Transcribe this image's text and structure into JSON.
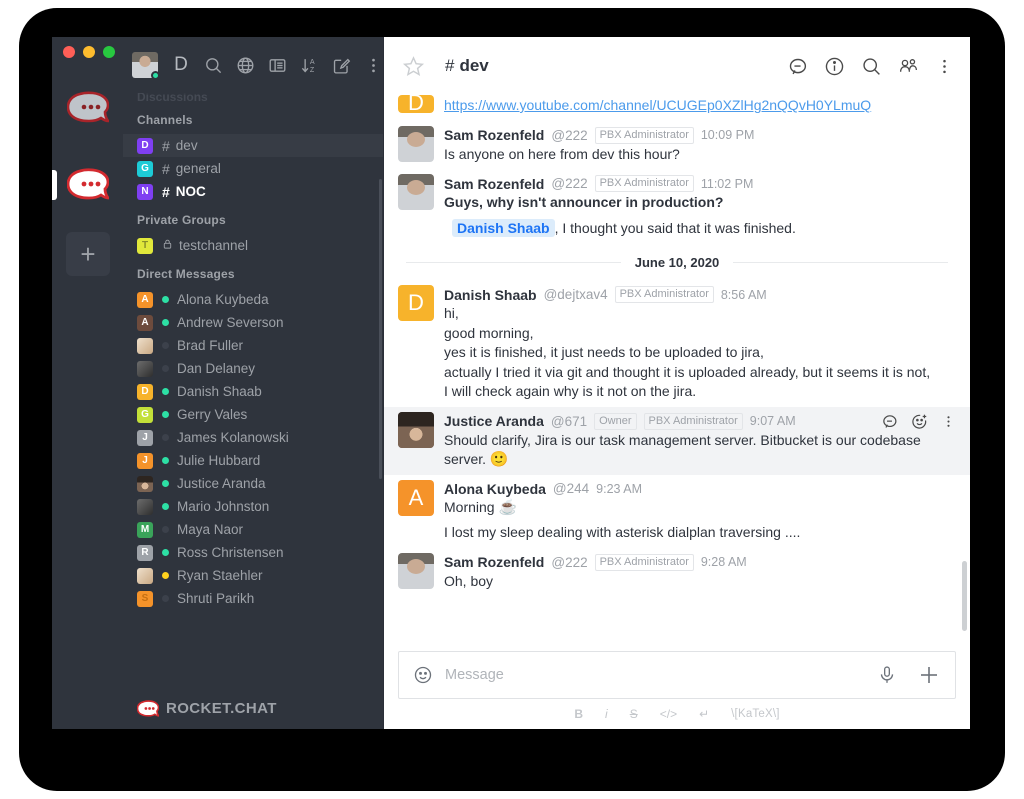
{
  "window": {
    "traffic_lights": [
      "close",
      "minimize",
      "maximize"
    ]
  },
  "rail": {
    "servers": [
      {
        "name": "rocket-chat-server-1",
        "active": false
      },
      {
        "name": "rocket-chat-server-2",
        "active": true
      }
    ],
    "add_label": "+"
  },
  "sidebar": {
    "toolbar": {
      "avatar_status": "online",
      "home_letter": "D",
      "icons": [
        "home-letter",
        "search-icon",
        "directory-globe-icon",
        "kanban-icon",
        "sort-az-icon",
        "create-new-icon",
        "kebab-menu-icon"
      ]
    },
    "ghost_section": "Discussions",
    "sections": [
      {
        "title": "Channels",
        "items": [
          {
            "label": "dev",
            "avatar_letter": "D",
            "avatar_color": "#7f3ff2",
            "prefix": "#",
            "active": true,
            "unread": false
          },
          {
            "label": "general",
            "avatar_letter": "G",
            "avatar_color": "#1dcbd6",
            "prefix": "#",
            "active": false,
            "unread": false
          },
          {
            "label": "NOC",
            "avatar_letter": "N",
            "avatar_color": "#7f3ff2",
            "prefix": "#",
            "active": false,
            "unread": true
          }
        ]
      },
      {
        "title": "Private Groups",
        "items": [
          {
            "label": "testchannel",
            "avatar_letter": "T",
            "avatar_color": "#e1e83b",
            "avatar_text_color": "#8a8f2a",
            "prefix": "lock",
            "active": false,
            "unread": false
          }
        ]
      },
      {
        "title": "Direct Messages",
        "items": [
          {
            "label": "Alona Kuybeda",
            "avatar_letter": "A",
            "avatar_color": "#f5932a",
            "status": "online"
          },
          {
            "label": "Andrew Severson",
            "avatar_letter": "A",
            "avatar_color": "#6d4b3d",
            "status": "online"
          },
          {
            "label": "Brad Fuller",
            "avatar_letter": "",
            "avatar_color": "#d9cbb4",
            "status": "offline",
            "photo": "beige"
          },
          {
            "label": "Dan Delaney",
            "avatar_letter": "",
            "avatar_color": "#5a5a5a",
            "status": "offline",
            "photo": "gray"
          },
          {
            "label": "Danish Shaab",
            "avatar_letter": "D",
            "avatar_color": "#f7b32b",
            "status": "online"
          },
          {
            "label": "Gerry Vales",
            "avatar_letter": "G",
            "avatar_color": "#c3e039",
            "avatar_text_color": "#ffffff",
            "status": "online"
          },
          {
            "label": "James Kolanowski",
            "avatar_letter": "J",
            "avatar_color": "#9ea2a8",
            "status": "offline"
          },
          {
            "label": "Julie Hubbard",
            "avatar_letter": "J",
            "avatar_color": "#f5932a",
            "status": "online"
          },
          {
            "label": "Justice Aranda",
            "avatar_letter": "",
            "avatar_color": "#5c4a42",
            "status": "online",
            "photo": "portrait"
          },
          {
            "label": "Mario Johnston",
            "avatar_letter": "",
            "avatar_color": "#4a4a4a",
            "status": "online",
            "photo": "gray"
          },
          {
            "label": "Maya Naor",
            "avatar_letter": "M",
            "avatar_color": "#3aa35a",
            "status": "offline"
          },
          {
            "label": "Ross Christensen",
            "avatar_letter": "R",
            "avatar_color": "#9ea2a8",
            "status": "online"
          },
          {
            "label": "Ryan Staehler",
            "avatar_letter": "",
            "avatar_color": "#d8c0a8",
            "status": "away",
            "photo": "beige"
          },
          {
            "label": "Shruti Parikh",
            "avatar_letter": "S",
            "avatar_color": "#f5932a",
            "avatar_text_color": "#c56f12",
            "status": "offline"
          }
        ]
      }
    ],
    "footer_wordmark": "ROCKET.CHAT"
  },
  "chat": {
    "header": {
      "star_icon": "favorite-star-icon",
      "hash": "#",
      "title": "dev",
      "actions": [
        "threads-icon",
        "info-icon",
        "search-icon",
        "members-icon",
        "kebab-menu-icon"
      ]
    },
    "date_divider": "June 10, 2020",
    "messages": [
      {
        "id": "msg-0",
        "partial": true,
        "avatar_letter": "D",
        "avatar_color": "#f7b32b",
        "link": "https://www.youtube.com/channel/UCUGEp0XZlHg2nQQvH0YLmuQ"
      },
      {
        "id": "msg-1",
        "user": "Sam Rozenfeld",
        "handle": "@222",
        "tag": "PBX Administrator",
        "time": "10:09 PM",
        "avatar_photo": "sam",
        "text": "Is anyone on here from dev this hour?"
      },
      {
        "id": "msg-2",
        "user": "Sam Rozenfeld",
        "handle": "@222",
        "tag": "PBX Administrator",
        "time": "11:02 PM",
        "avatar_photo": "sam",
        "text_bold": "Guys, why isn't announcer in production?",
        "mention": "Danish Shaab",
        "text_after_mention": ", I thought you said that it was finished."
      },
      {
        "id": "msg-3",
        "user": "Danish Shaab",
        "handle": "@dejtxav4",
        "tag": "PBX Administrator",
        "time": "8:56 AM",
        "avatar_letter": "D",
        "avatar_color": "#f7b32b",
        "lines": [
          "hi,",
          "good morning,",
          "yes it is finished, it just needs to be uploaded to jira,",
          "actually I tried it via git and thought it is uploaded already, but it seems it is not,",
          "I will check again why is it not on the jira."
        ]
      },
      {
        "id": "msg-4",
        "user": "Justice Aranda",
        "handle": "@671",
        "owner_tag": "Owner",
        "tag": "PBX Administrator",
        "time": "9:07 AM",
        "avatar_photo": "justice",
        "hovered": true,
        "text": "Should clarify, Jira is our task management server. Bitbucket is our codebase server. ",
        "emoji": "🙂",
        "hover_actions": [
          "reply-in-thread-icon",
          "add-reaction-icon",
          "kebab-menu-icon"
        ]
      },
      {
        "id": "msg-5",
        "user": "Alona Kuybeda",
        "handle": "@244",
        "time": "9:23 AM",
        "avatar_letter": "A",
        "avatar_color": "#f5932a",
        "text": "Morning ",
        "emoji": "☕",
        "followup": "I lost my sleep dealing with asterisk dialplan traversing ...."
      },
      {
        "id": "msg-6",
        "user": "Sam Rozenfeld",
        "handle": "@222",
        "tag": "PBX Administrator",
        "time": "9:28 AM",
        "avatar_photo": "sam",
        "text": "Oh, boy"
      }
    ],
    "composer": {
      "emoji_icon": "emoji-smiley-icon",
      "placeholder": "Message",
      "value": "",
      "audio_icon": "microphone-icon",
      "plus_icon": "plus-icon",
      "format_buttons": [
        {
          "name": "bold",
          "label": "B"
        },
        {
          "name": "italic",
          "label": "i"
        },
        {
          "name": "strike",
          "label": "S"
        },
        {
          "name": "code",
          "label": "</>"
        },
        {
          "name": "multiline",
          "label": "↵"
        },
        {
          "name": "katex",
          "label": "\\[KaTeX\\]"
        }
      ]
    }
  },
  "colors": {
    "sidebar_bg": "#2f343d",
    "sidebar_active": "#373c45",
    "accent_link": "#4c9beb",
    "mention_bg": "#dcecfb",
    "mention_fg": "#1d74f5",
    "hover_bg": "#f2f3f5",
    "online": "#2de0a5",
    "away": "#ffd21e",
    "offline": "#3c414b"
  }
}
